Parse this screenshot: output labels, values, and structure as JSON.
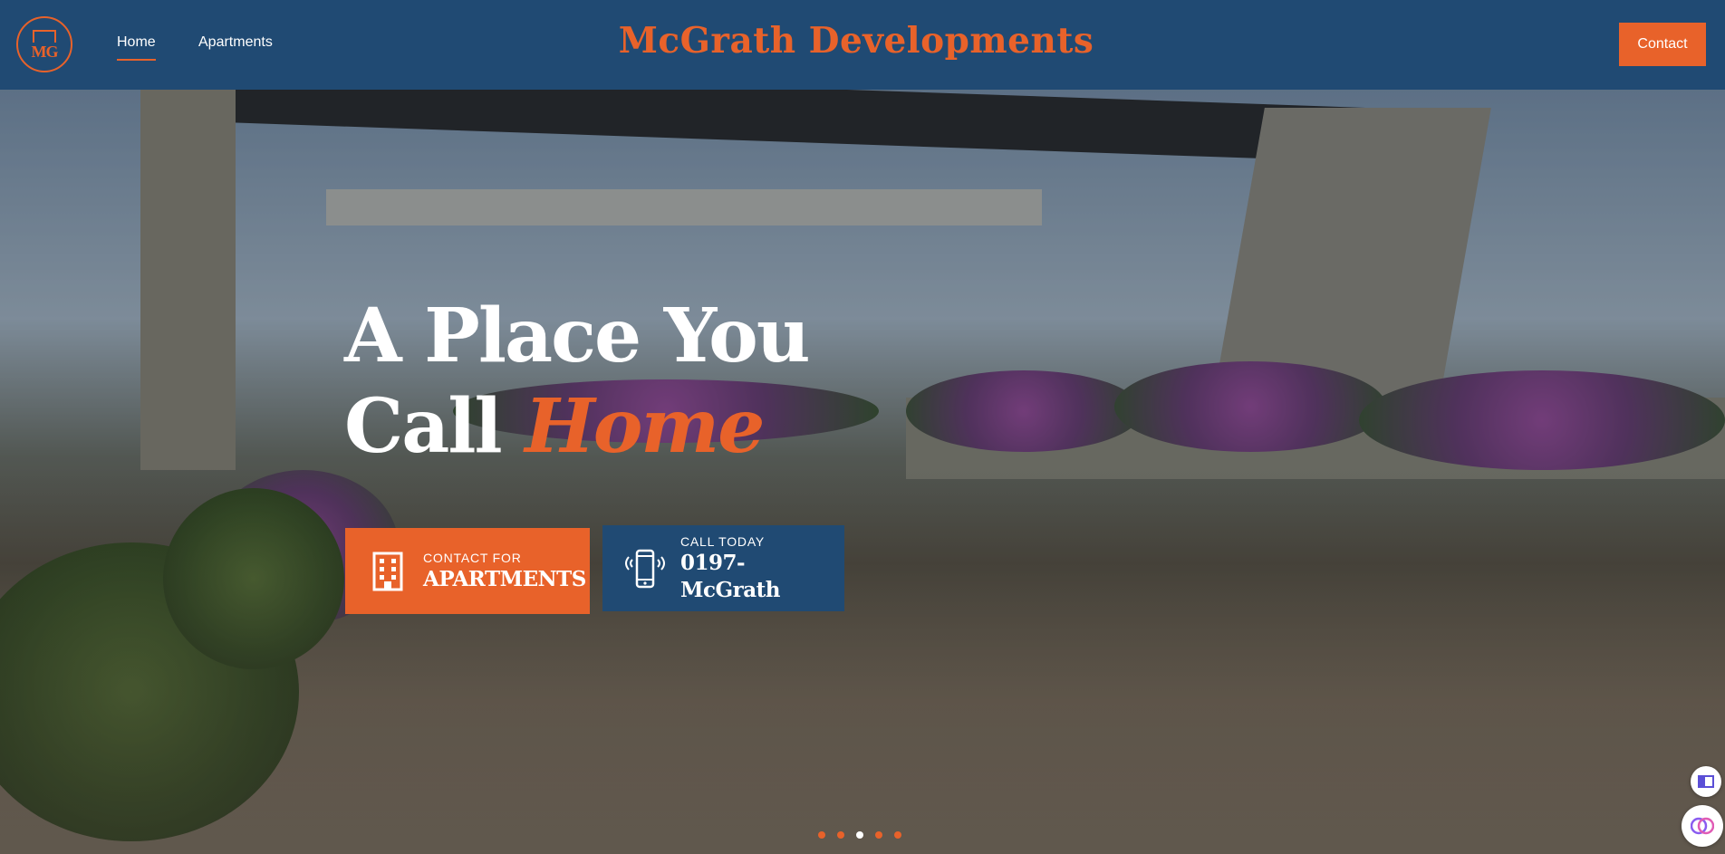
{
  "header": {
    "nav": [
      {
        "label": "Home"
      },
      {
        "label": "Apartments"
      }
    ],
    "brand_title": "McGrath Developments",
    "contact_label": "Contact",
    "logo_text": "MG"
  },
  "hero": {
    "headline_line1": "A Place You",
    "headline_line2_plain": "Call",
    "headline_line2_accent": "Home",
    "cta_apartments": {
      "small": "Contact For",
      "big": "APARTMENTS",
      "icon": "building-icon"
    },
    "cta_call": {
      "small": "Call Today",
      "big": "0197-McGrath",
      "icon": "phone-icon"
    },
    "slider": {
      "count": 5,
      "active_index": 2
    }
  },
  "colors": {
    "header_bg": "#204a73",
    "accent": "#e8622a",
    "white": "#ffffff"
  },
  "floating_buttons": [
    "book-icon",
    "brain-icon"
  ]
}
